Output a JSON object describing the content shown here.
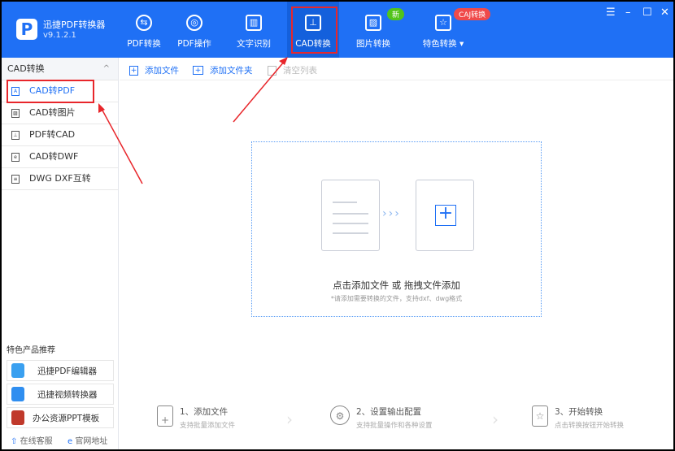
{
  "app": {
    "name": "迅捷PDF转换器",
    "version": "v9.1.2.1",
    "logo": "P"
  },
  "nav": [
    {
      "label": "PDF转换",
      "icon": "⇆"
    },
    {
      "label": "PDF操作",
      "icon": "◎"
    },
    {
      "label": "文字识别",
      "icon": "▥"
    },
    {
      "label": "CAD转换",
      "icon": "⊥"
    },
    {
      "label": "图片转换",
      "icon": "▨"
    },
    {
      "label": "特色转换 ▾",
      "icon": "☆"
    }
  ],
  "badges": {
    "new": "新",
    "caj": "CAJ转换"
  },
  "window_controls": {
    "menu": "☰",
    "min": "–",
    "max": "☐",
    "close": "✕"
  },
  "sidebar": {
    "title": "CAD转换",
    "items": [
      {
        "label": "CAD转PDF",
        "icon": "A"
      },
      {
        "label": "CAD转图片",
        "icon": "▨"
      },
      {
        "label": "PDF转CAD",
        "icon": "⊥"
      },
      {
        "label": "CAD转DWF",
        "icon": "e"
      },
      {
        "label": "DWG DXF互转",
        "icon": "≡"
      }
    ],
    "rec_title": "特色产品推荐",
    "recs": [
      "迅捷PDF编辑器",
      "迅捷视频转换器",
      "办公资源PPT模板"
    ],
    "online": "在线客服",
    "website": "官网地址"
  },
  "toolbar": {
    "add_file": "添加文件",
    "add_folder": "添加文件夹",
    "clear": "清空列表"
  },
  "drop": {
    "main": "点击添加文件 或 拖拽文件添加",
    "sub": "*请添加需要转换的文件，支持dxf、dwg格式",
    "arrows": "›››",
    "plus": "+"
  },
  "steps": [
    {
      "title": "1、添加文件",
      "desc": "支持批量添加文件"
    },
    {
      "title": "2、设置输出配置",
      "desc": "支持批量操作和各种设置"
    },
    {
      "title": "3、开始转换",
      "desc": "点击转换按钮开始转换"
    }
  ],
  "colors": {
    "accent": "#1f70f5",
    "annotation": "#e8262b"
  }
}
